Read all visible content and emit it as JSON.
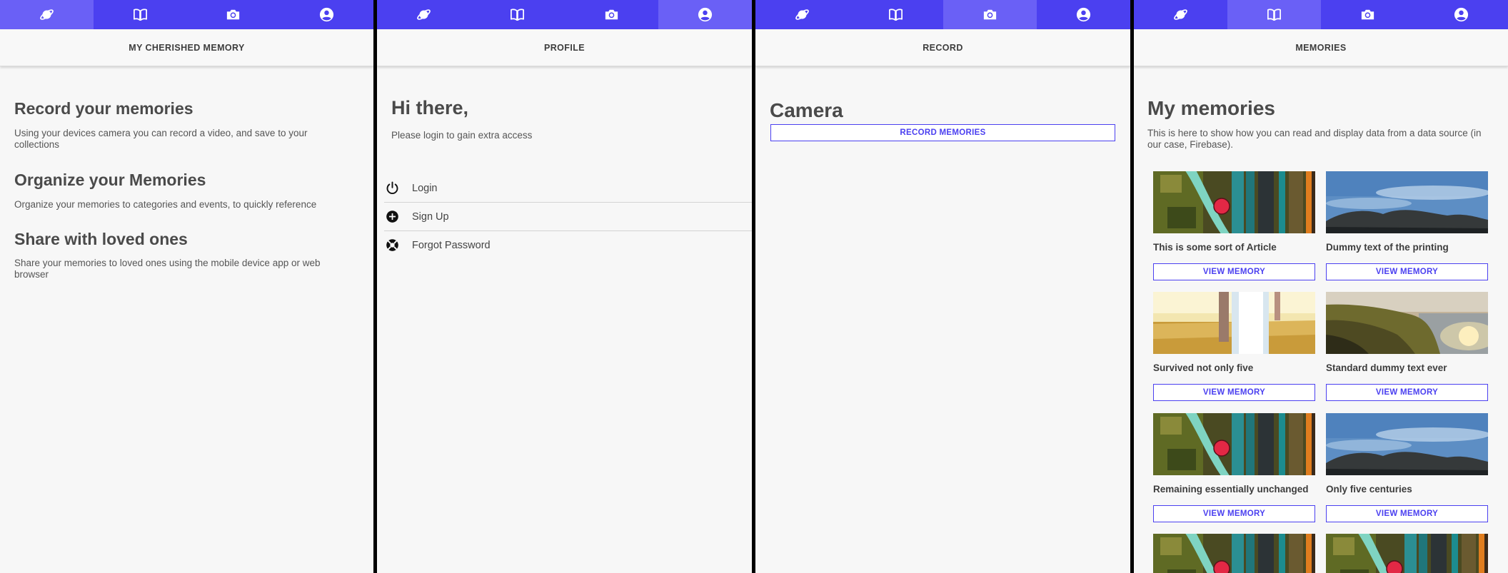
{
  "tab_icons": [
    "planet-icon",
    "book-icon",
    "camera-icon",
    "account-icon"
  ],
  "colors": {
    "primary": "#4b40f0",
    "active_tab": "#6a60f6"
  },
  "home": {
    "title": "MY CHERISHED MEMORY",
    "sections": [
      {
        "heading": "Record your memories",
        "text": "Using your devices camera you can record a video, and save to your collections"
      },
      {
        "heading": "Organize your Memories",
        "text": "Organize your memories to categories and events, to quickly reference"
      },
      {
        "heading": "Share with loved ones",
        "text": "Share your memories to loved ones using the mobile device app or web browser"
      }
    ]
  },
  "profile": {
    "title": "PROFILE",
    "greeting": "Hi there,",
    "subtitle": "Please login to gain extra access",
    "menu": [
      {
        "label": "Login",
        "icon": "power-icon"
      },
      {
        "label": "Sign Up",
        "icon": "add-circle-icon"
      },
      {
        "label": "Forgot Password",
        "icon": "help-buoy-icon"
      }
    ]
  },
  "record": {
    "title": "RECORD",
    "heading": "Camera",
    "button": "RECORD MEMORIES"
  },
  "memories": {
    "title": "MEMORIES",
    "heading": "My memories",
    "subtitle": "This is here to show how you can read and display data from a data source (in our case, Firebase).",
    "button_label": "VIEW MEMORY",
    "items": [
      {
        "title": "This is some sort of Article",
        "image": "bike-image"
      },
      {
        "title": "Dummy text of the printing",
        "image": "sky-image"
      },
      {
        "title": "Survived not only five",
        "image": "field-image"
      },
      {
        "title": "Standard dummy text ever",
        "image": "coast-image"
      },
      {
        "title": "Remaining essentially unchanged",
        "image": "bike-image"
      },
      {
        "title": "Only five centuries",
        "image": "sky-image"
      },
      {
        "title": "",
        "image": "bike-image"
      },
      {
        "title": "",
        "image": "bike-image"
      }
    ]
  }
}
